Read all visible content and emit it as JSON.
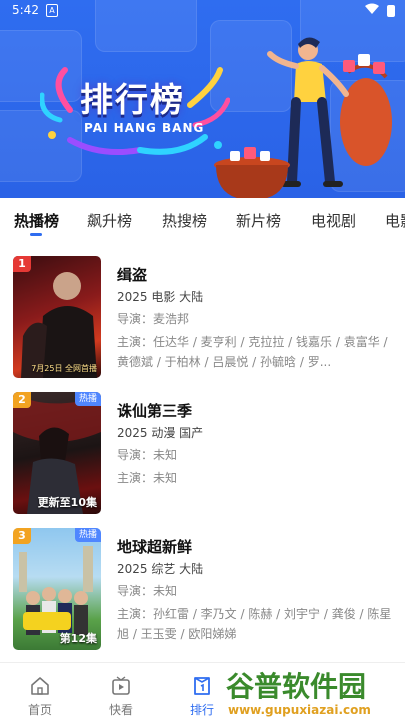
{
  "statusbar": {
    "time": "5:42",
    "badge": "A"
  },
  "banner": {
    "title": "排行榜",
    "subtitle": "PAI HANG BANG"
  },
  "tabs": [
    {
      "label": "热播榜",
      "active": true
    },
    {
      "label": "飙升榜"
    },
    {
      "label": "热搜榜"
    },
    {
      "label": "新片榜"
    },
    {
      "label": "电视剧"
    },
    {
      "label": "电影"
    }
  ],
  "items": [
    {
      "rank": "1",
      "rank_color": "#e53935",
      "hot": "",
      "title": "缉盗",
      "meta": "2025  电影  大陆",
      "director": "导演：麦浩邦",
      "cast": "主演：任达华 / 麦亨利 / 克拉拉 / 钱嘉乐 / 袁富华 / 黄德斌 / 于柏林 / 吕晨悦 / 孙毓晗 / 罗...",
      "poster_caption": "7月25日 全网首播"
    },
    {
      "rank": "2",
      "rank_color": "#f2a321",
      "hot": "热播",
      "title": "诛仙第三季",
      "meta": "2025  动漫  国产",
      "director": "导演：未知",
      "cast": "主演：未知",
      "poster_caption": "更新至10集"
    },
    {
      "rank": "3",
      "rank_color": "#f2a321",
      "hot": "热播",
      "title": "地球超新鲜",
      "meta": "2025  综艺  大陆",
      "director": "导演：未知",
      "cast": "主演：孙红雷 / 李乃文 / 陈赫 / 刘宇宁 / 龚俊 / 陈星旭 / 王玉雯 / 欧阳娣娣",
      "poster_caption": "第12集"
    }
  ],
  "bottomnav": [
    {
      "label": "首页",
      "icon": "home-icon"
    },
    {
      "label": "快看",
      "icon": "play-icon"
    },
    {
      "label": "排行",
      "icon": "ranking-icon",
      "active": true
    }
  ],
  "watermark": {
    "text": "谷普软件园",
    "url": "www.gupuxiazai.com"
  }
}
